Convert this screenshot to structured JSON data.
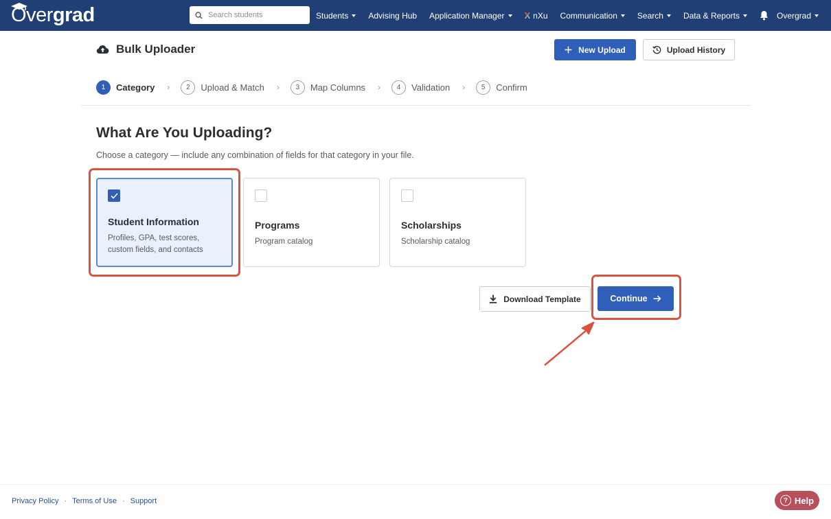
{
  "nav": {
    "logo": {
      "o": "O",
      "ver": "ver",
      "grad": "grad"
    },
    "search_placeholder": "Search students",
    "items": [
      {
        "label": "Students",
        "dropdown": true
      },
      {
        "label": "Advising Hub",
        "dropdown": false
      },
      {
        "label": "Application Manager",
        "dropdown": true
      },
      {
        "label": "nXu",
        "dropdown": false
      },
      {
        "label": "Communication",
        "dropdown": true
      },
      {
        "label": "Search",
        "dropdown": true
      },
      {
        "label": "Data & Reports",
        "dropdown": true
      }
    ],
    "nxu_mark": "X",
    "user_menu": "Overgrad"
  },
  "header": {
    "title": "Bulk Uploader",
    "new_upload_label": "New Upload",
    "upload_history_label": "Upload History"
  },
  "stepper": {
    "steps": [
      {
        "num": "1",
        "label": "Category",
        "active": true
      },
      {
        "num": "2",
        "label": "Upload & Match",
        "active": false
      },
      {
        "num": "3",
        "label": "Map Columns",
        "active": false
      },
      {
        "num": "4",
        "label": "Validation",
        "active": false
      },
      {
        "num": "5",
        "label": "Confirm",
        "active": false
      }
    ],
    "separator": "›"
  },
  "main": {
    "heading": "What Are You Uploading?",
    "subtext": "Choose a category — include any combination of fields for that category in your file.",
    "categories": [
      {
        "title": "Student Information",
        "description": "Profiles, GPA, test scores, custom fields, and contacts",
        "selected": true
      },
      {
        "title": "Programs",
        "description": "Program catalog",
        "selected": false
      },
      {
        "title": "Scholarships",
        "description": "Scholarship catalog",
        "selected": false
      }
    ],
    "download_template_label": "Download Template",
    "continue_label": "Continue"
  },
  "footer": {
    "links": [
      "Privacy Policy",
      "Terms of Use",
      "Support"
    ],
    "separator": "·",
    "help_label": "Help",
    "help_glyph": "?"
  },
  "colors": {
    "nav_bg": "#1f3f75",
    "primary": "#2f5fb8",
    "highlight": "#d9533f",
    "selected_bg": "#eaf1fd",
    "help_bg": "#b8505c"
  },
  "icons": {
    "logo": "graduation-cap-icon",
    "search": "search-icon",
    "bell": "bell-icon",
    "title": "cloud-upload-icon",
    "new_upload": "plus-icon",
    "upload_history": "history-icon",
    "download": "download-icon",
    "continue": "arrow-right-icon",
    "checkbox": "checkmark-icon",
    "help": "question-icon"
  }
}
